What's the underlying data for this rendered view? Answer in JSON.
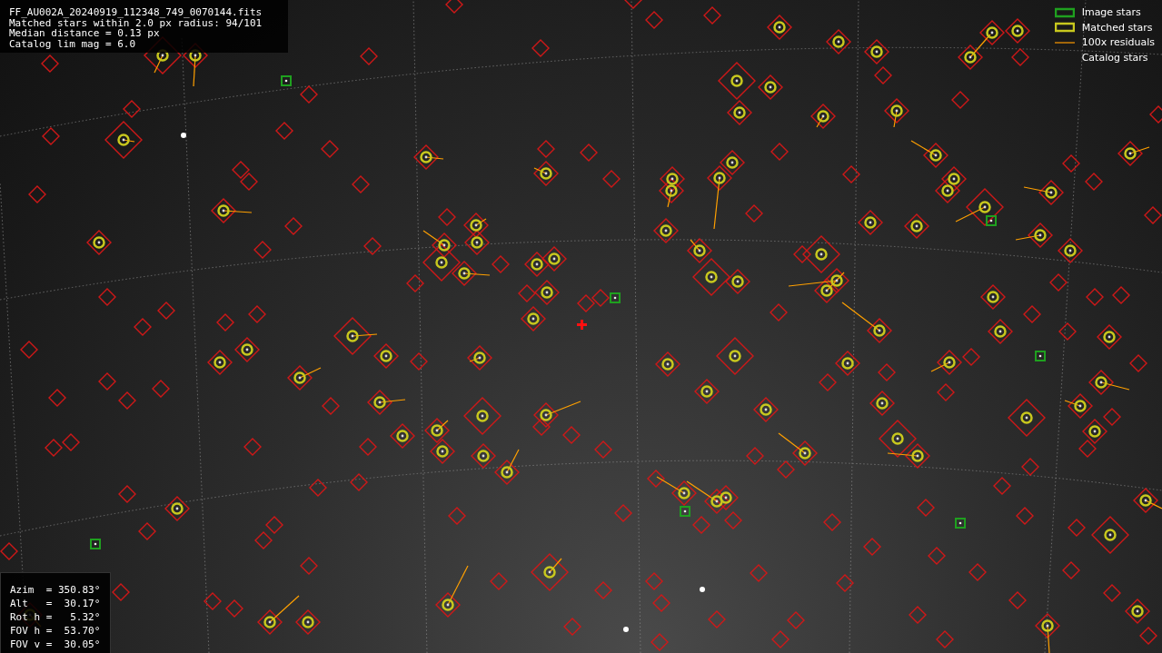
{
  "info_top": {
    "lines": [
      "FF_AU002A_20240919_112348_749_0070144.fits",
      "Matched stars within 2.0 px radius: 94/101",
      "Median distance = 0.13 px",
      "Catalog lim mag = 6.0"
    ]
  },
  "legend": [
    {
      "kind": "image",
      "label": "Image stars"
    },
    {
      "kind": "matched",
      "label": "Matched stars"
    },
    {
      "kind": "residual",
      "label": "100x residuals"
    },
    {
      "kind": "catalog",
      "label": "Catalog stars"
    }
  ],
  "info_bottom": {
    "lines": [
      "Azim  = 350.83°",
      "Alt   =  30.17°",
      "Rot h =   5.32°",
      "FOV h =  53.70°",
      "FOV v =  30.05°"
    ]
  }
}
